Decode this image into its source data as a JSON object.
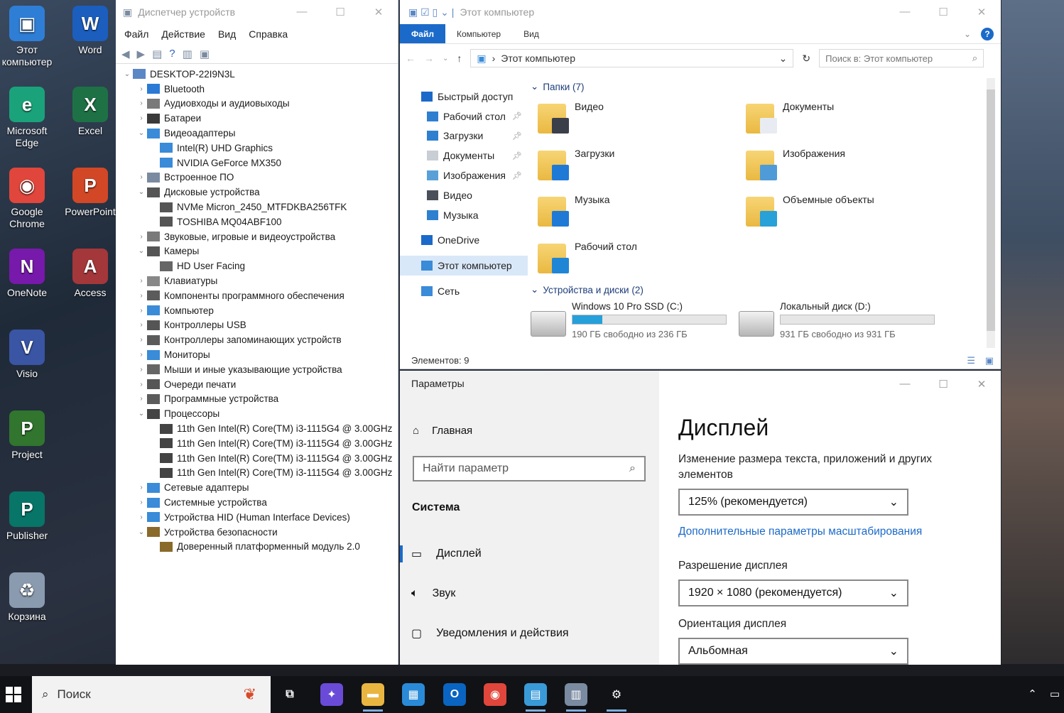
{
  "desktop": {
    "icons": [
      {
        "label": "Этот компьютер",
        "icon": "this-pc-icon",
        "color": "#2e7ed6"
      },
      {
        "label": "Word",
        "icon": "word-icon",
        "color": "#1b5ebe"
      },
      {
        "label": "Microsoft Edge",
        "icon": "edge-icon",
        "color": "#1aa37a"
      },
      {
        "label": "Excel",
        "icon": "excel-icon",
        "color": "#1e7145"
      },
      {
        "label": "Google Chrome",
        "icon": "chrome-icon",
        "color": "#e0463b"
      },
      {
        "label": "PowerPoint",
        "icon": "powerpoint-icon",
        "color": "#d24726"
      },
      {
        "label": "OneNote",
        "icon": "onenote-icon",
        "color": "#7719aa"
      },
      {
        "label": "Access",
        "icon": "access-icon",
        "color": "#a4373a"
      },
      {
        "label": "Visio",
        "icon": "visio-icon",
        "color": "#3955a3"
      },
      {
        "label": "Project",
        "icon": "project-icon",
        "color": "#31752f"
      },
      {
        "label": "Publisher",
        "icon": "publisher-icon",
        "color": "#077568"
      },
      {
        "label": "Корзина",
        "icon": "recycle-bin-icon",
        "color": "#8a9bb0"
      }
    ],
    "glyphs": [
      "▣",
      "W",
      "e",
      "X",
      "◉",
      "P",
      "N",
      "A",
      "V",
      "P",
      "P",
      "♻"
    ]
  },
  "devmgr": {
    "title": "Диспетчер устройств",
    "menu": [
      "Файл",
      "Действие",
      "Вид",
      "Справка"
    ],
    "root": "DESKTOP-22I9N3L",
    "tree": [
      {
        "label": "Bluetooth",
        "level": 1,
        "exp": "›"
      },
      {
        "label": "Аудиовходы и аудиовыходы",
        "level": 1,
        "exp": "›"
      },
      {
        "label": "Батареи",
        "level": 1,
        "exp": "›"
      },
      {
        "label": "Видеоадаптеры",
        "level": 1,
        "exp": "⌄"
      },
      {
        "label": "Intel(R) UHD Graphics",
        "level": 2,
        "exp": ""
      },
      {
        "label": "NVIDIA GeForce MX350",
        "level": 2,
        "exp": ""
      },
      {
        "label": "Встроенное ПО",
        "level": 1,
        "exp": "›"
      },
      {
        "label": "Дисковые устройства",
        "level": 1,
        "exp": "⌄"
      },
      {
        "label": "NVMe Micron_2450_MTFDKBA256TFK",
        "level": 2,
        "exp": ""
      },
      {
        "label": "TOSHIBA MQ04ABF100",
        "level": 2,
        "exp": ""
      },
      {
        "label": "Звуковые, игровые и видеоустройства",
        "level": 1,
        "exp": "›"
      },
      {
        "label": "Камеры",
        "level": 1,
        "exp": "⌄"
      },
      {
        "label": "HD User Facing",
        "level": 2,
        "exp": ""
      },
      {
        "label": "Клавиатуры",
        "level": 1,
        "exp": "›"
      },
      {
        "label": "Компоненты программного обеспечения",
        "level": 1,
        "exp": "›"
      },
      {
        "label": "Компьютер",
        "level": 1,
        "exp": "›"
      },
      {
        "label": "Контроллеры USB",
        "level": 1,
        "exp": "›"
      },
      {
        "label": "Контроллеры запоминающих устройств",
        "level": 1,
        "exp": "›"
      },
      {
        "label": "Мониторы",
        "level": 1,
        "exp": "›"
      },
      {
        "label": "Мыши и иные указывающие устройства",
        "level": 1,
        "exp": "›"
      },
      {
        "label": "Очереди печати",
        "level": 1,
        "exp": "›"
      },
      {
        "label": "Программные устройства",
        "level": 1,
        "exp": "›"
      },
      {
        "label": "Процессоры",
        "level": 1,
        "exp": "⌄"
      },
      {
        "label": "11th Gen Intel(R) Core(TM) i3-1115G4 @ 3.00GHz",
        "level": 2,
        "exp": ""
      },
      {
        "label": "11th Gen Intel(R) Core(TM) i3-1115G4 @ 3.00GHz",
        "level": 2,
        "exp": ""
      },
      {
        "label": "11th Gen Intel(R) Core(TM) i3-1115G4 @ 3.00GHz",
        "level": 2,
        "exp": ""
      },
      {
        "label": "11th Gen Intel(R) Core(TM) i3-1115G4 @ 3.00GHz",
        "level": 2,
        "exp": ""
      },
      {
        "label": "Сетевые адаптеры",
        "level": 1,
        "exp": "›"
      },
      {
        "label": "Системные устройства",
        "level": 1,
        "exp": "›"
      },
      {
        "label": "Устройства HID (Human Interface Devices)",
        "level": 1,
        "exp": "›"
      },
      {
        "label": "Устройства безопасности",
        "level": 1,
        "exp": "⌄"
      },
      {
        "label": "Доверенный платформенный модуль 2.0",
        "level": 2,
        "exp": ""
      }
    ]
  },
  "explorer": {
    "title": "Этот компьютер",
    "ribbon": {
      "file": "Файл",
      "tabs": [
        "Компьютер",
        "Вид"
      ]
    },
    "address": "Этот компьютер",
    "search_placeholder": "Поиск в: Этот компьютер",
    "nav": [
      {
        "label": "Быстрый доступ",
        "sub": false,
        "pin": false,
        "color": "#1b6ac9"
      },
      {
        "label": "Рабочий стол",
        "sub": true,
        "pin": true,
        "color": "#2f7fd0"
      },
      {
        "label": "Загрузки",
        "sub": true,
        "pin": true,
        "color": "#2f7fd0"
      },
      {
        "label": "Документы",
        "sub": true,
        "pin": true,
        "color": "#c9cdd4"
      },
      {
        "label": "Изображения",
        "sub": true,
        "pin": true,
        "color": "#5aa0d8"
      },
      {
        "label": "Видео",
        "sub": true,
        "pin": false,
        "color": "#4a4f5a"
      },
      {
        "label": "Музыка",
        "sub": true,
        "pin": false,
        "color": "#2f7fd0"
      },
      {
        "label": "OneDrive",
        "sub": false,
        "pin": false,
        "color": "#1b6ac9"
      },
      {
        "label": "Этот компьютер",
        "sub": false,
        "pin": false,
        "color": "#3a8bd8"
      },
      {
        "label": "Сеть",
        "sub": false,
        "pin": false,
        "color": "#3a8bd8"
      }
    ],
    "folders_header": "Папки (7)",
    "folders": [
      {
        "label": "Видео",
        "badge": "#3b3f4a"
      },
      {
        "label": "Документы",
        "badge": "#e8ecf2"
      },
      {
        "label": "Загрузки",
        "badge": "#1f7ad6"
      },
      {
        "label": "Изображения",
        "badge": "#4f9bd8"
      },
      {
        "label": "Музыка",
        "badge": "#1f7ad6"
      },
      {
        "label": "Объемные объекты",
        "badge": "#28a0d8"
      },
      {
        "label": "Рабочий стол",
        "badge": "#1f86d6"
      }
    ],
    "drives_header": "Устройства и диски (2)",
    "drives": [
      {
        "name": "Windows 10 Pro SSD (C:)",
        "free": "190 ГБ свободно из 236 ГБ",
        "used_fraction": 0.195
      },
      {
        "name": "Локальный диск (D:)",
        "free": "931 ГБ свободно из 931 ГБ",
        "used_fraction": 0.0
      }
    ],
    "status": "Элементов: 9"
  },
  "settings": {
    "title": "Параметры",
    "home": "Главная",
    "search_placeholder": "Найти параметр",
    "section": "Система",
    "nav": [
      "Дисплей",
      "Звук",
      "Уведомления и действия"
    ],
    "heading": "Дисплей",
    "scale_label": "Изменение размера текста, приложений и других элементов",
    "scale_value": "125% (рекомендуется)",
    "scale_link": "Дополнительные параметры масштабирования",
    "resolution_label": "Разрешение дисплея",
    "resolution_value": "1920 × 1080 (рекомендуется)",
    "orientation_label": "Ориентация дисплея",
    "orientation_value": "Альбомная"
  },
  "taskbar": {
    "search_placeholder": "Поиск",
    "apps": [
      {
        "name": "task-view",
        "glyph": "⧉",
        "color": "#101216"
      },
      {
        "name": "copilot",
        "glyph": "✦",
        "color": "#6a4bd8"
      },
      {
        "name": "file-explorer",
        "glyph": "▬",
        "color": "#e8b640"
      },
      {
        "name": "microsoft-store",
        "glyph": "▦",
        "color": "#2a8ad8"
      },
      {
        "name": "outlook",
        "glyph": "O",
        "color": "#0a64c2"
      },
      {
        "name": "chrome",
        "glyph": "◉",
        "color": "#e0463b"
      },
      {
        "name": "control-panel",
        "glyph": "▤",
        "color": "#3a9ad8"
      },
      {
        "name": "device-manager",
        "glyph": "▥",
        "color": "#7a8aa0"
      },
      {
        "name": "settings",
        "glyph": "⚙",
        "color": "#101216"
      }
    ]
  }
}
